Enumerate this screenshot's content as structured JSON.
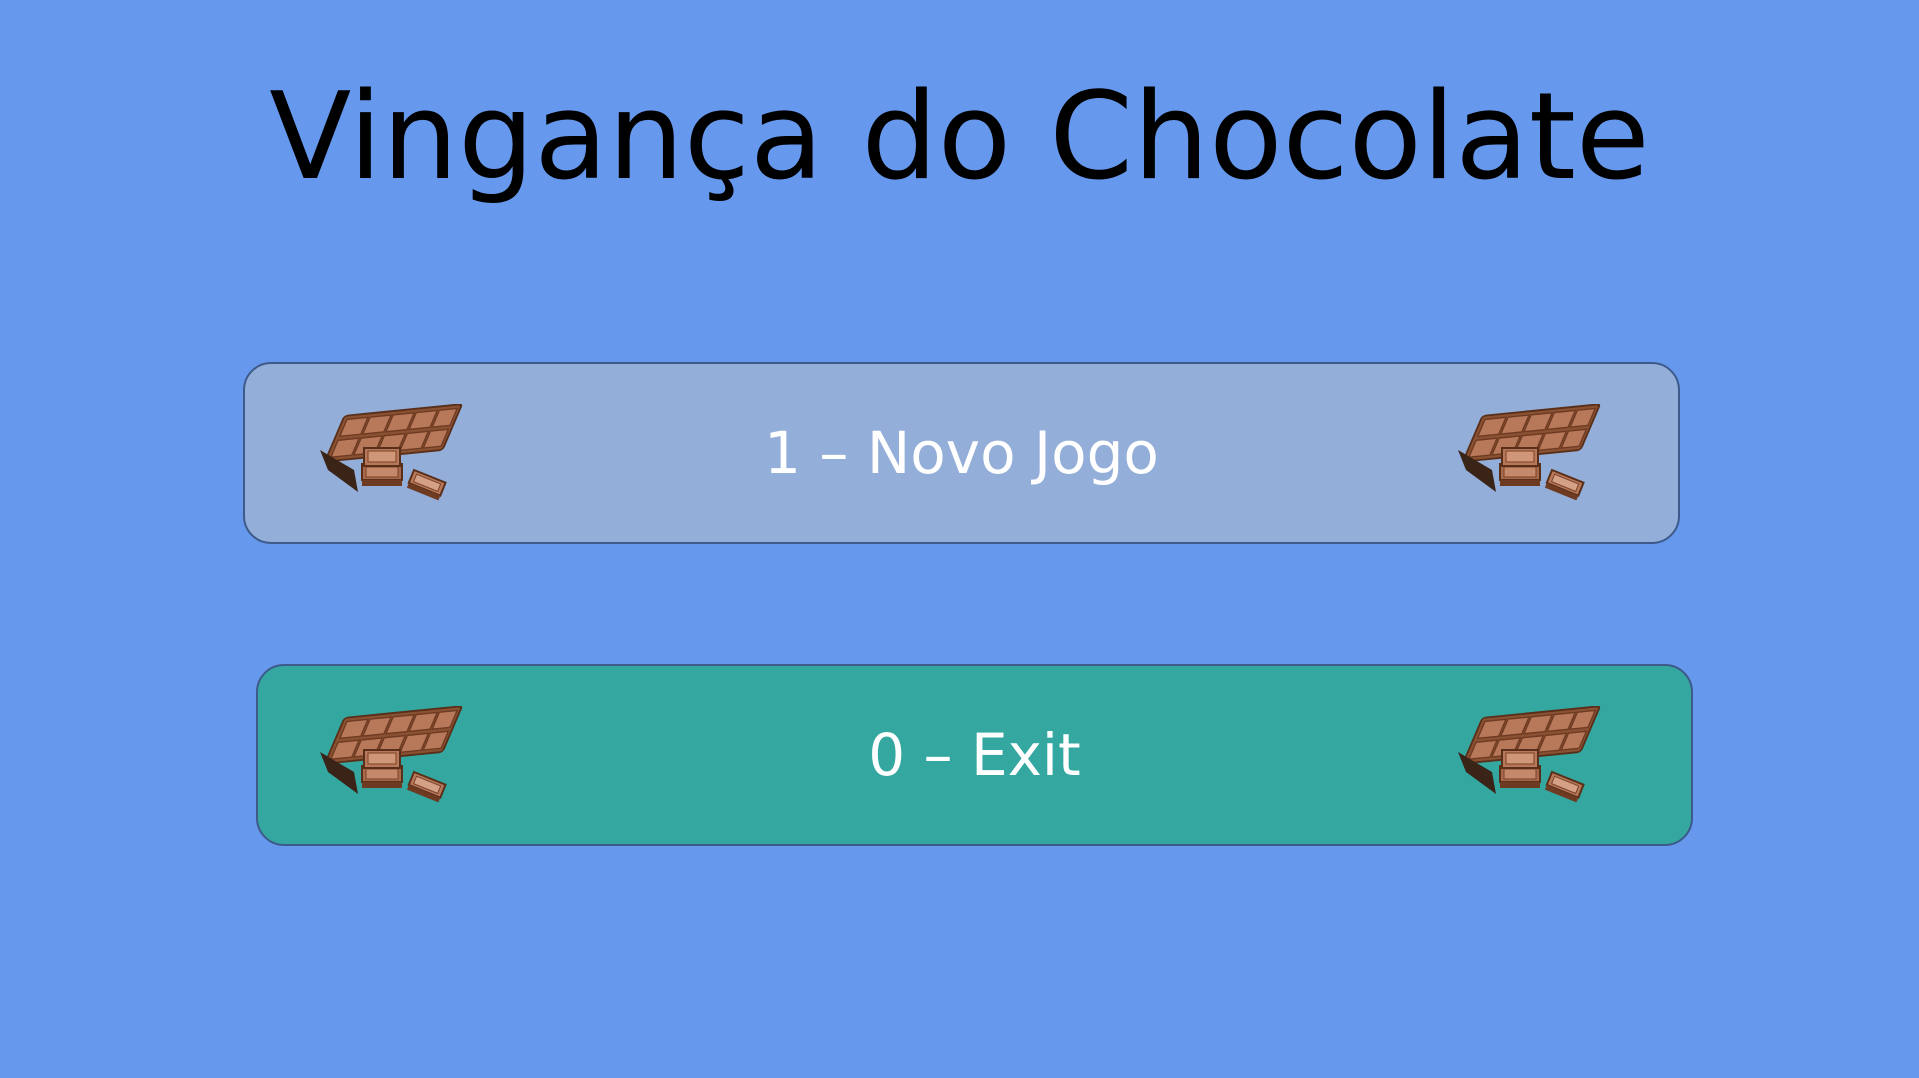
{
  "title": "Vingança do Chocolate",
  "menu": {
    "new_game_label": "1 – Novo Jogo",
    "exit_label": "0 – Exit"
  },
  "colors": {
    "background": "#6699ee",
    "new_game_button": "#93aed8",
    "exit_button": "#34a8a0",
    "button_border": "#3d5a8a",
    "title_text": "#000000",
    "button_text": "#ffffff"
  },
  "icons": {
    "decoration": "chocolate-bar-icon"
  }
}
